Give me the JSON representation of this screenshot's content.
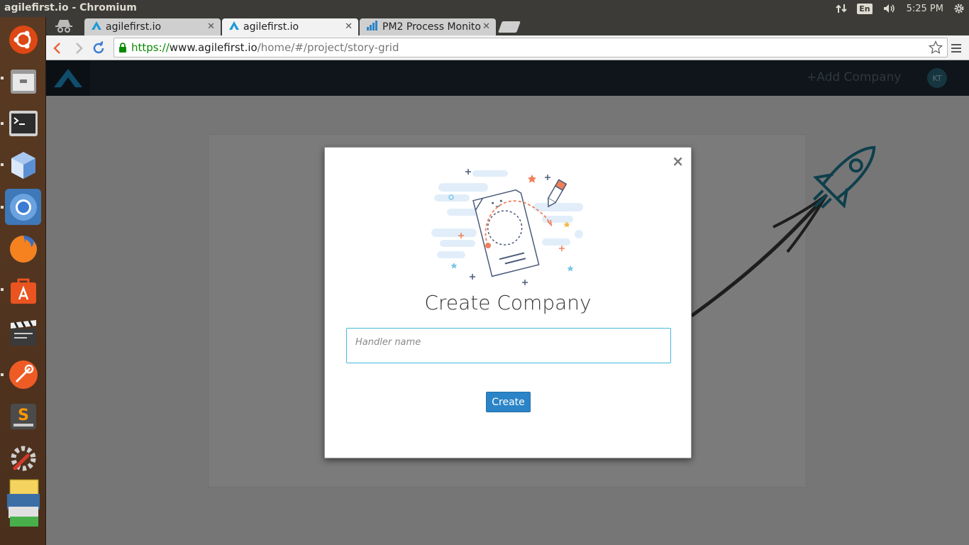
{
  "os": {
    "window_title": "agilefirst.io - Chromium",
    "keyboard_layout": "En",
    "clock": "5:25 PM"
  },
  "launcher": {
    "apps": [
      {
        "name": "ubuntu-dash-icon",
        "color": "#dd4814"
      },
      {
        "name": "files-icon",
        "color": "#8a8a8a"
      },
      {
        "name": "terminal-icon",
        "color": "#2c2c2c"
      },
      {
        "name": "virtualbox-icon",
        "color": "#5b8fd4"
      },
      {
        "name": "chromium-icon",
        "color": "#4a86c5"
      },
      {
        "name": "firefox-icon",
        "color": "#e66000"
      },
      {
        "name": "software-center-icon",
        "color": "#e95420"
      },
      {
        "name": "video-editor-icon",
        "color": "#444444"
      },
      {
        "name": "postman-icon",
        "color": "#ef5b25"
      },
      {
        "name": "sublime-text-icon",
        "color": "#4b4b4b"
      },
      {
        "name": "system-settings-icon",
        "color": "#7a7a7a"
      },
      {
        "name": "notes-icon",
        "color": "#f4d35e"
      }
    ]
  },
  "browser": {
    "tabs": [
      {
        "label": "agilefirst.io",
        "active": false
      },
      {
        "label": "agilefirst.io",
        "active": true
      },
      {
        "label": "PM2 Process Monito",
        "active": false
      }
    ],
    "url": {
      "scheme": "https://",
      "host": "www.agilefirst.io",
      "path": "/home/#/project/story-grid"
    }
  },
  "app": {
    "header": {
      "add_company": "+Add Company",
      "avatar_initials": "KT"
    },
    "modal": {
      "close": "×",
      "title": "Create Company",
      "input_placeholder": "Handler name",
      "input_value": "",
      "create_label": "Create"
    }
  },
  "colors": {
    "accent": "#2b84c7",
    "input_border": "#46b8da",
    "header_bg": "#1f2a35",
    "illustration_orange": "#f07f5a"
  }
}
